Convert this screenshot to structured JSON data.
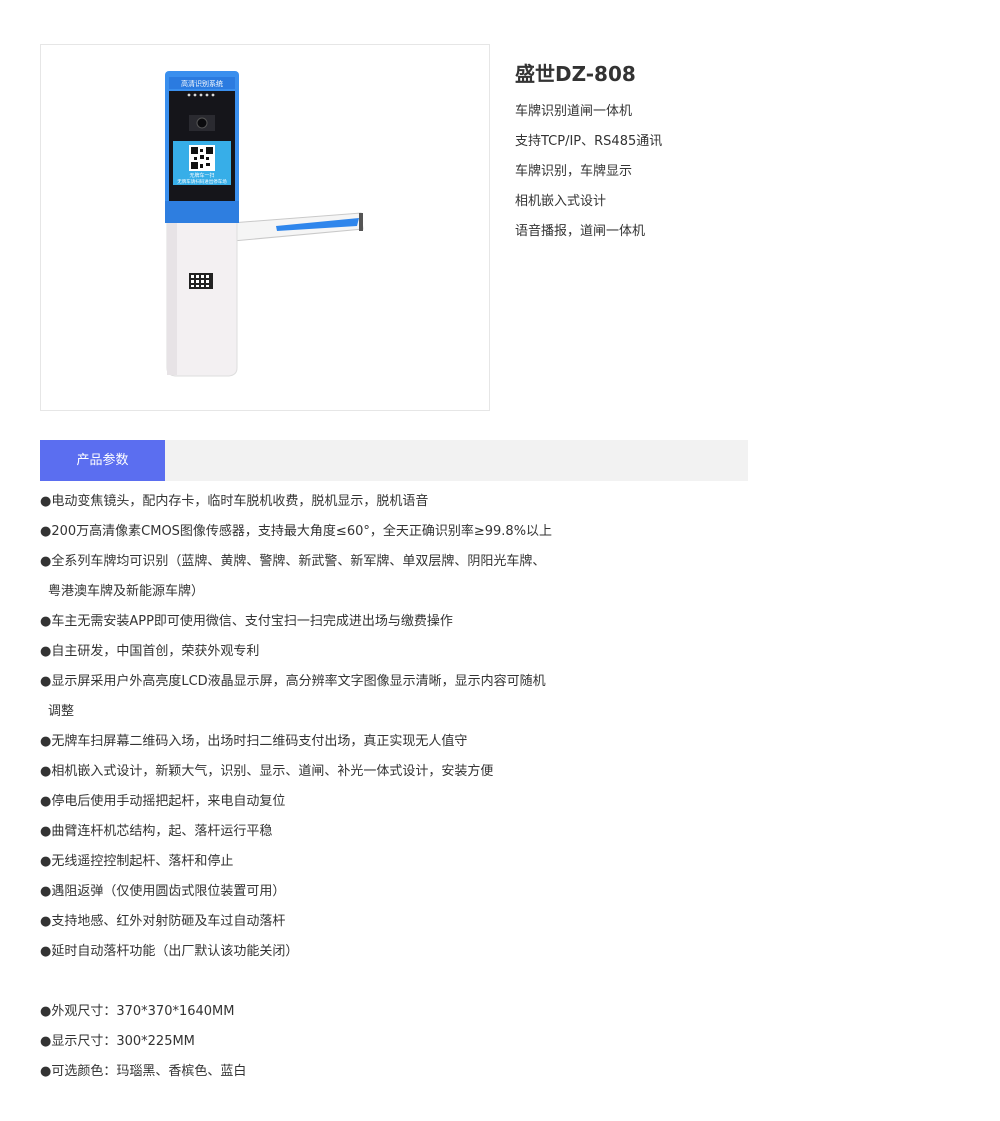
{
  "product": {
    "title": "盛世DZ-808",
    "features": [
      "车牌识别道闸一体机",
      "支持TCP/IP、RS485通讯",
      "车牌识别，车牌显示",
      "相机嵌入式设计",
      "语音播报，道闸一体机"
    ],
    "image": {
      "screen_header": "高清识别系统",
      "screen_line1": "无牌车一扫",
      "screen_line2": "无牌车请扫码进出停车场"
    }
  },
  "tabs": [
    {
      "label": "产品参数",
      "active": true
    }
  ],
  "specs": [
    "●电动变焦镜头，配内存卡，临时车脱机收费，脱机显示，脱机语音",
    "●200万高清像素CMOS图像传感器，支持最大角度≤60°，全天正确识别率≥99.8%以上",
    "●全系列车牌均可识别（蓝牌、黄牌、警牌、新武警、新军牌、单双层牌、阴阳光车牌、",
    "粤港澳车牌及新能源车牌）",
    "●车主无需安装APP即可使用微信、支付宝扫一扫完成进出场与缴费操作",
    "●自主研发，中国首创，荣获外观专利",
    "●显示屏采用户外高亮度LCD液晶显示屏，高分辨率文字图像显示清晰，显示内容可随机",
    "调整",
    "●无牌车扫屏幕二维码入场，出场时扫二维码支付出场，真正实现无人值守",
    "●相机嵌入式设计，新颖大气，识别、显示、道闸、补光一体式设计，安装方便",
    "●停电后使用手动摇把起杆，来电自动复位",
    "●曲臂连杆机芯结构，起、落杆运行平稳",
    "●无线遥控控制起杆、落杆和停止",
    "●遇阻返弹（仅使用圆齿式限位装置可用）",
    "●支持地感、红外对射防砸及车过自动落杆",
    "●延时自动落杆功能（出厂默认该功能关闭）",
    "",
    "●外观尺寸：370*370*1640MM",
    "●显示尺寸：300*225MM",
    "●可选颜色：玛瑙黑、香槟色、蓝白"
  ],
  "colors": {
    "accent": "#5b6ef0",
    "tab_bar_bg": "#f2f2f2",
    "device_blue": "#3a8fee",
    "device_body": "#f3f0f2"
  }
}
